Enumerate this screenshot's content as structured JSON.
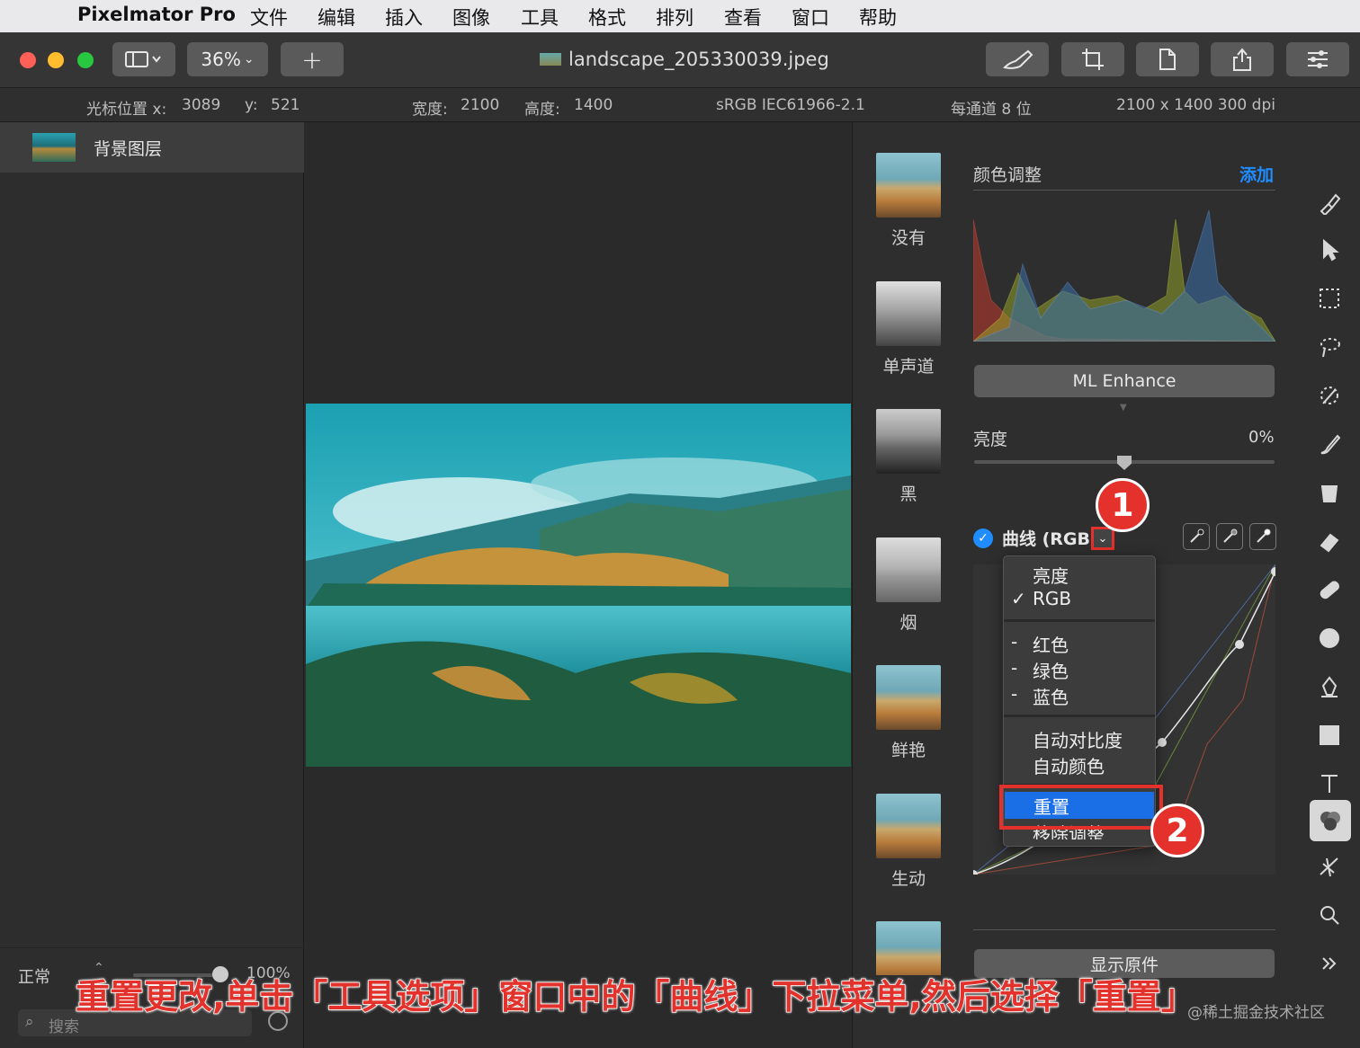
{
  "menubar": {
    "apple_icon": "apple-icon",
    "app_name": "Pixelmator Pro",
    "items": [
      "文件",
      "编辑",
      "插入",
      "图像",
      "工具",
      "格式",
      "排列",
      "查看",
      "窗口",
      "帮助"
    ]
  },
  "toolbar": {
    "zoom": "36%",
    "add_symbol": "+",
    "document_title": "landscape_205330039.jpeg"
  },
  "infobar": {
    "cursor_label": "光标位置 x:",
    "cursor_x": "3089",
    "y_label": "y:",
    "cursor_y": "521",
    "width_label": "宽度:",
    "width_value": "2100",
    "height_label": "高度:",
    "height_value": "1400",
    "color_profile": "sRGB IEC61966-2.1",
    "bit_depth": "每通道 8 位",
    "dimensions": "2100 x 1400 300 dpi"
  },
  "layers": {
    "items": [
      {
        "label": "背景图层"
      }
    ],
    "blend_mode": "正常",
    "opacity": "100%",
    "search_placeholder": "搜索"
  },
  "presets": [
    "没有",
    "单声道",
    "黑",
    "烟",
    "鲜艳",
    "生动"
  ],
  "adjustments": {
    "title": "颜色调整",
    "add_label": "添加",
    "ml_enhance": "ML Enhance",
    "brightness_label": "亮度",
    "brightness_value": "0%",
    "curves_label": "曲线 (RGB",
    "show_original": "显示原件"
  },
  "curves_menu": {
    "items": [
      {
        "label": "亮度",
        "checked": ""
      },
      {
        "label": "RGB",
        "checked": "✓"
      },
      {
        "label": "红色",
        "checked": "-"
      },
      {
        "label": "绿色",
        "checked": "-"
      },
      {
        "label": "蓝色",
        "checked": "-"
      },
      {
        "label": "自动对比度",
        "checked": ""
      },
      {
        "label": "自动颜色",
        "checked": ""
      },
      {
        "label": "重置",
        "checked": ""
      },
      {
        "label": "移除调整",
        "checked": ""
      }
    ]
  },
  "annotations": {
    "badge1": "1",
    "badge2": "2",
    "caption": "重置更改,单击「工具选项」窗口中的「曲线」下拉菜单,然后选择「重置」",
    "watermark": "@稀土掘金技术社区"
  },
  "colors": {
    "accent": "#1f8cff",
    "highlight": "#e4312b",
    "selection": "#1a6fe6"
  }
}
